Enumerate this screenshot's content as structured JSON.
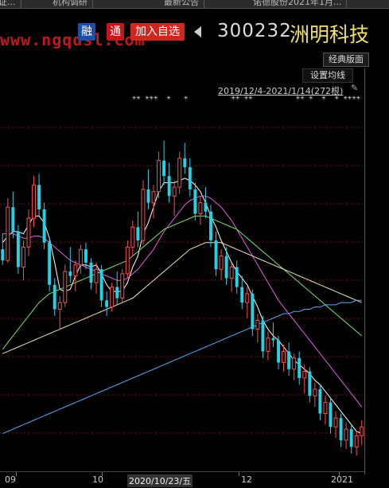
{
  "tabs": [
    "证...",
    "机构调研",
    "最新公告",
    "诺德股份2021年1月..."
  ],
  "watermark": "www.ngqdsl.com",
  "toolbar": {
    "rong_label": "融",
    "tong_label": "通",
    "add_label": "加入自选",
    "stock_code": "300232",
    "stock_name": "洲明科技"
  },
  "controls": {
    "classic_layout": "经典版面",
    "ma_settings": "设置均线",
    "date_range": "2019/12/4-2021/1/14(272根)"
  },
  "event_markers": "☀☀ ☀☀☀  ☀   ☀          ☀☀ ☀☀          ☀☀ ☀  ☀  ☀ ☀☀☀☀",
  "x_axis": {
    "labels": [
      "09",
      "10",
      "2020/10/23/五",
      "12",
      "2021"
    ],
    "highlight": "2020/10/23/五"
  },
  "colors": {
    "up": "#ff4d4d",
    "down": "#22d3e8",
    "ma5": "#ffffff",
    "ma10": "#f1e15b",
    "ma20": "#e05fe0",
    "ma60": "#7ee06a",
    "ma120": "#e8e3b8",
    "ma250": "#5aa8f0",
    "grid": "#7a1010"
  },
  "chart_data": {
    "type": "candlestick",
    "series_points": 70,
    "candles": [
      [
        24.5,
        25.2,
        23.8,
        24.0
      ],
      [
        24.0,
        26.8,
        23.9,
        26.4
      ],
      [
        26.4,
        27.1,
        25.0,
        25.3
      ],
      [
        25.3,
        25.6,
        23.4,
        23.7
      ],
      [
        23.7,
        24.9,
        23.1,
        24.6
      ],
      [
        24.6,
        26.3,
        24.2,
        25.9
      ],
      [
        25.9,
        27.8,
        25.5,
        27.4
      ],
      [
        27.4,
        27.9,
        26.0,
        26.3
      ],
      [
        26.3,
        26.6,
        24.5,
        24.8
      ],
      [
        24.8,
        25.0,
        22.6,
        22.9
      ],
      [
        22.9,
        23.2,
        21.5,
        21.8
      ],
      [
        21.8,
        22.4,
        20.9,
        22.1
      ],
      [
        22.1,
        23.8,
        21.9,
        23.5
      ],
      [
        23.5,
        24.6,
        23.0,
        23.3
      ],
      [
        23.3,
        24.0,
        22.6,
        23.8
      ],
      [
        23.8,
        24.7,
        23.4,
        24.5
      ],
      [
        24.5,
        24.8,
        23.6,
        23.9
      ],
      [
        23.9,
        24.1,
        22.7,
        23.0
      ],
      [
        23.0,
        23.9,
        22.5,
        23.6
      ],
      [
        23.6,
        23.8,
        21.9,
        22.2
      ],
      [
        22.2,
        22.6,
        21.5,
        21.9
      ],
      [
        21.9,
        23.0,
        21.7,
        22.8
      ],
      [
        22.8,
        23.5,
        22.0,
        22.3
      ],
      [
        22.3,
        23.6,
        22.1,
        23.4
      ],
      [
        23.4,
        24.9,
        23.2,
        24.6
      ],
      [
        24.6,
        25.8,
        24.2,
        25.5
      ],
      [
        25.5,
        26.2,
        24.6,
        24.9
      ],
      [
        24.9,
        27.6,
        24.7,
        27.2
      ],
      [
        27.2,
        28.1,
        26.3,
        26.6
      ],
      [
        26.6,
        27.4,
        25.9,
        27.1
      ],
      [
        27.1,
        28.9,
        26.8,
        28.5
      ],
      [
        28.5,
        29.4,
        27.4,
        27.8
      ],
      [
        27.8,
        28.4,
        26.6,
        26.9
      ],
      [
        26.9,
        27.6,
        26.0,
        27.3
      ],
      [
        27.3,
        28.9,
        27.0,
        28.6
      ],
      [
        28.6,
        29.3,
        27.9,
        28.2
      ],
      [
        28.2,
        28.6,
        26.9,
        27.2
      ],
      [
        27.2,
        27.5,
        25.8,
        26.1
      ],
      [
        26.1,
        26.9,
        25.6,
        26.6
      ],
      [
        26.6,
        27.3,
        25.9,
        26.2
      ],
      [
        26.2,
        26.5,
        24.6,
        24.9
      ],
      [
        24.9,
        25.3,
        23.3,
        23.6
      ],
      [
        23.6,
        24.5,
        23.1,
        24.2
      ],
      [
        24.2,
        24.6,
        22.9,
        23.2
      ],
      [
        23.2,
        23.9,
        22.6,
        23.7
      ],
      [
        23.7,
        24.0,
        22.5,
        22.8
      ],
      [
        22.8,
        23.3,
        21.8,
        22.1
      ],
      [
        22.1,
        22.8,
        21.4,
        22.5
      ],
      [
        22.5,
        22.7,
        20.6,
        20.9
      ],
      [
        20.9,
        21.6,
        20.3,
        21.3
      ],
      [
        21.3,
        21.5,
        19.6,
        19.9
      ],
      [
        19.9,
        20.8,
        19.5,
        20.5
      ],
      [
        20.5,
        21.2,
        20.1,
        20.4
      ],
      [
        20.4,
        20.6,
        19.1,
        19.4
      ],
      [
        19.4,
        20.2,
        19.0,
        19.9
      ],
      [
        19.9,
        20.3,
        18.8,
        19.1
      ],
      [
        19.1,
        19.8,
        18.6,
        19.6
      ],
      [
        19.6,
        19.9,
        18.4,
        18.7
      ],
      [
        18.7,
        19.3,
        18.0,
        19.0
      ],
      [
        19.0,
        19.2,
        17.6,
        17.9
      ],
      [
        17.9,
        18.5,
        17.4,
        18.2
      ],
      [
        18.2,
        18.4,
        16.8,
        17.1
      ],
      [
        17.1,
        17.9,
        16.6,
        17.6
      ],
      [
        17.6,
        17.8,
        16.2,
        16.5
      ],
      [
        16.5,
        17.2,
        16.0,
        16.9
      ],
      [
        16.9,
        17.1,
        15.6,
        15.9
      ],
      [
        15.9,
        16.7,
        15.5,
        16.4
      ],
      [
        16.4,
        16.6,
        15.3,
        15.6
      ],
      [
        15.6,
        16.3,
        15.2,
        16.1
      ],
      [
        16.1,
        16.8,
        15.7,
        16.5
      ]
    ],
    "ylim": [
      14.5,
      31.5
    ],
    "grid": true,
    "ma_lines": [
      {
        "name": "MA5",
        "color_key": "ma5",
        "values": [
          24.8,
          25.1,
          25.3,
          25.3,
          25.2,
          25.6,
          26.0,
          26.0,
          25.7,
          25.0,
          23.9,
          22.7,
          22.6,
          22.7,
          23.3,
          23.8,
          23.8,
          23.7,
          23.8,
          23.4,
          22.9,
          22.6,
          22.6,
          22.6,
          23.0,
          23.7,
          24.2,
          25.2,
          25.7,
          26.4,
          27.1,
          27.5,
          27.5,
          27.5,
          27.6,
          27.7,
          27.6,
          27.4,
          27.1,
          26.6,
          26.0,
          25.5,
          24.9,
          24.4,
          23.9,
          23.5,
          23.2,
          22.9,
          22.4,
          21.9,
          21.3,
          20.9,
          20.6,
          20.4,
          20.1,
          19.8,
          19.5,
          19.3,
          19.1,
          18.9,
          18.6,
          18.4,
          18.1,
          17.8,
          17.5,
          17.2,
          16.9,
          16.6,
          16.3,
          16.2
        ]
      },
      {
        "name": "MA20",
        "color_key": "ma20",
        "values": [
          25.2,
          25.2,
          25.2,
          25.1,
          25.0,
          25.0,
          25.1,
          25.1,
          25.0,
          24.8,
          24.6,
          24.4,
          24.2,
          24.0,
          23.9,
          23.8,
          23.7,
          23.6,
          23.5,
          23.4,
          23.3,
          23.2,
          23.1,
          23.1,
          23.2,
          23.4,
          23.6,
          23.9,
          24.2,
          24.5,
          24.9,
          25.3,
          25.6,
          25.9,
          26.2,
          26.5,
          26.7,
          26.8,
          26.9,
          26.9,
          26.8,
          26.6,
          26.4,
          26.1,
          25.8,
          25.4,
          25.0,
          24.6,
          24.2,
          23.8,
          23.4,
          23.0,
          22.6,
          22.2,
          21.9,
          21.6,
          21.3,
          21.0,
          20.7,
          20.4,
          20.1,
          19.8,
          19.5,
          19.2,
          18.9,
          18.6,
          18.3,
          18.0,
          17.7,
          17.4
        ]
      },
      {
        "name": "MA60",
        "color_key": "ma60",
        "values": [
          20.0,
          20.3,
          20.6,
          20.9,
          21.2,
          21.5,
          21.8,
          22.1,
          22.3,
          22.5,
          22.6,
          22.7,
          22.8,
          22.9,
          23.0,
          23.1,
          23.2,
          23.3,
          23.4,
          23.5,
          23.6,
          23.7,
          23.8,
          23.9,
          24.0,
          24.2,
          24.4,
          24.6,
          24.8,
          25.0,
          25.2,
          25.4,
          25.5,
          25.6,
          25.7,
          25.8,
          25.9,
          26.0,
          26.0,
          26.0,
          25.9,
          25.8,
          25.7,
          25.6,
          25.5,
          25.4,
          25.2,
          25.0,
          24.8,
          24.6,
          24.4,
          24.2,
          24.0,
          23.8,
          23.6,
          23.4,
          23.2,
          23.0,
          22.8,
          22.6,
          22.4,
          22.2,
          22.0,
          21.8,
          21.6,
          21.4,
          21.2,
          21.0,
          20.8,
          20.6
        ]
      },
      {
        "name": "MA120",
        "color_key": "ma120",
        "values": [
          19.8,
          19.9,
          20.0,
          20.1,
          20.2,
          20.3,
          20.4,
          20.5,
          20.6,
          20.7,
          20.8,
          20.9,
          21.0,
          21.1,
          21.2,
          21.3,
          21.4,
          21.5,
          21.6,
          21.7,
          21.8,
          21.9,
          22.0,
          22.1,
          22.2,
          22.3,
          22.5,
          22.7,
          22.9,
          23.1,
          23.3,
          23.5,
          23.7,
          23.9,
          24.1,
          24.3,
          24.5,
          24.6,
          24.7,
          24.8,
          24.8,
          24.8,
          24.8,
          24.7,
          24.6,
          24.5,
          24.4,
          24.3,
          24.2,
          24.1,
          24.0,
          23.9,
          23.8,
          23.7,
          23.6,
          23.5,
          23.4,
          23.3,
          23.2,
          23.1,
          23.0,
          22.9,
          22.8,
          22.7,
          22.6,
          22.5,
          22.4,
          22.3,
          22.2,
          22.1
        ]
      },
      {
        "name": "MA250",
        "color_key": "ma250",
        "values": [
          16.2,
          16.3,
          16.4,
          16.5,
          16.6,
          16.7,
          16.8,
          16.9,
          17.0,
          17.1,
          17.2,
          17.3,
          17.4,
          17.5,
          17.6,
          17.7,
          17.8,
          17.9,
          18.0,
          18.1,
          18.2,
          18.3,
          18.4,
          18.5,
          18.6,
          18.7,
          18.8,
          18.9,
          19.0,
          19.1,
          19.2,
          19.3,
          19.4,
          19.5,
          19.6,
          19.7,
          19.8,
          19.9,
          20.0,
          20.1,
          20.2,
          20.3,
          20.4,
          20.5,
          20.6,
          20.7,
          20.8,
          20.9,
          21.0,
          21.1,
          21.2,
          21.3,
          21.4,
          21.5,
          21.6,
          21.6,
          21.7,
          21.7,
          21.8,
          21.8,
          21.9,
          21.9,
          22.0,
          22.0,
          22.0,
          22.1,
          22.1,
          22.1,
          22.2,
          22.2
        ]
      }
    ]
  }
}
